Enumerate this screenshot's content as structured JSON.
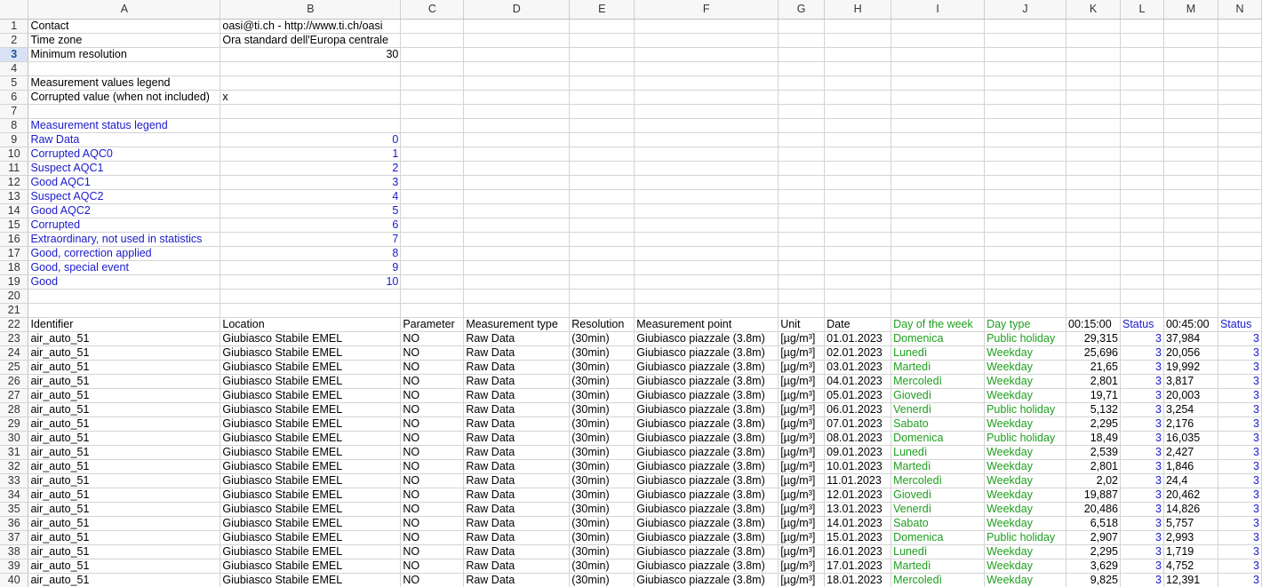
{
  "columns": [
    "A",
    "B",
    "C",
    "D",
    "E",
    "F",
    "G",
    "H",
    "I",
    "J",
    "K",
    "L",
    "M",
    "N"
  ],
  "selected_row": 3,
  "meta": {
    "contact_label": "Contact",
    "contact_value": "oasi@ti.ch - http://www.ti.ch/oasi",
    "timezone_label": "Time zone",
    "timezone_value": "Ora standard dell'Europa centrale",
    "minres_label": "Minimum resolution",
    "minres_value": "30",
    "values_legend_title": "Measurement values legend",
    "corrupted_label": "Corrupted value (when not included)",
    "corrupted_value": "x",
    "status_legend_title": "Measurement status legend"
  },
  "status_legend": [
    {
      "label": "Raw Data",
      "code": "0"
    },
    {
      "label": "Corrupted AQC0",
      "code": "1"
    },
    {
      "label": "Suspect AQC1",
      "code": "2"
    },
    {
      "label": "Good AQC1",
      "code": "3"
    },
    {
      "label": "Suspect AQC2",
      "code": "4"
    },
    {
      "label": "Good AQC2",
      "code": "5"
    },
    {
      "label": "Corrupted",
      "code": "6"
    },
    {
      "label": "Extraordinary, not used in statistics",
      "code": "7"
    },
    {
      "label": "Good, correction applied",
      "code": "8"
    },
    {
      "label": "Good, special event",
      "code": "9"
    },
    {
      "label": "Good",
      "code": "10"
    }
  ],
  "headers": [
    "Identifier",
    "Location",
    "Parameter",
    "Measurement type",
    "Resolution",
    "Measurement point",
    "Unit",
    "Date",
    "Day of the week",
    "Day type",
    "00:15:00",
    "Status",
    "00:45:00",
    "Status"
  ],
  "data_rows": [
    [
      "air_auto_51",
      "Giubiasco Stabile EMEL",
      "NO",
      "Raw Data",
      "(30min)",
      "Giubiasco piazzale (3.8m)",
      "[µg/m³]",
      "01.01.2023",
      "Domenica",
      "Public holiday",
      "29,315",
      "3",
      "37,984",
      "3"
    ],
    [
      "air_auto_51",
      "Giubiasco Stabile EMEL",
      "NO",
      "Raw Data",
      "(30min)",
      "Giubiasco piazzale (3.8m)",
      "[µg/m³]",
      "02.01.2023",
      "Lunedì",
      "Weekday",
      "25,696",
      "3",
      "20,056",
      "3"
    ],
    [
      "air_auto_51",
      "Giubiasco Stabile EMEL",
      "NO",
      "Raw Data",
      "(30min)",
      "Giubiasco piazzale (3.8m)",
      "[µg/m³]",
      "03.01.2023",
      "Martedì",
      "Weekday",
      "21,65",
      "3",
      "19,992",
      "3"
    ],
    [
      "air_auto_51",
      "Giubiasco Stabile EMEL",
      "NO",
      "Raw Data",
      "(30min)",
      "Giubiasco piazzale (3.8m)",
      "[µg/m³]",
      "04.01.2023",
      "Mercoledì",
      "Weekday",
      "2,801",
      "3",
      "3,817",
      "3"
    ],
    [
      "air_auto_51",
      "Giubiasco Stabile EMEL",
      "NO",
      "Raw Data",
      "(30min)",
      "Giubiasco piazzale (3.8m)",
      "[µg/m³]",
      "05.01.2023",
      "Giovedì",
      "Weekday",
      "19,71",
      "3",
      "20,003",
      "3"
    ],
    [
      "air_auto_51",
      "Giubiasco Stabile EMEL",
      "NO",
      "Raw Data",
      "(30min)",
      "Giubiasco piazzale (3.8m)",
      "[µg/m³]",
      "06.01.2023",
      "Venerdì",
      "Public holiday",
      "5,132",
      "3",
      "3,254",
      "3"
    ],
    [
      "air_auto_51",
      "Giubiasco Stabile EMEL",
      "NO",
      "Raw Data",
      "(30min)",
      "Giubiasco piazzale (3.8m)",
      "[µg/m³]",
      "07.01.2023",
      "Sabato",
      "Weekday",
      "2,295",
      "3",
      "2,176",
      "3"
    ],
    [
      "air_auto_51",
      "Giubiasco Stabile EMEL",
      "NO",
      "Raw Data",
      "(30min)",
      "Giubiasco piazzale (3.8m)",
      "[µg/m³]",
      "08.01.2023",
      "Domenica",
      "Public holiday",
      "18,49",
      "3",
      "16,035",
      "3"
    ],
    [
      "air_auto_51",
      "Giubiasco Stabile EMEL",
      "NO",
      "Raw Data",
      "(30min)",
      "Giubiasco piazzale (3.8m)",
      "[µg/m³]",
      "09.01.2023",
      "Lunedì",
      "Weekday",
      "2,539",
      "3",
      "2,427",
      "3"
    ],
    [
      "air_auto_51",
      "Giubiasco Stabile EMEL",
      "NO",
      "Raw Data",
      "(30min)",
      "Giubiasco piazzale (3.8m)",
      "[µg/m³]",
      "10.01.2023",
      "Martedì",
      "Weekday",
      "2,801",
      "3",
      "1,846",
      "3"
    ],
    [
      "air_auto_51",
      "Giubiasco Stabile EMEL",
      "NO",
      "Raw Data",
      "(30min)",
      "Giubiasco piazzale (3.8m)",
      "[µg/m³]",
      "11.01.2023",
      "Mercoledì",
      "Weekday",
      "2,02",
      "3",
      "24,4",
      "3"
    ],
    [
      "air_auto_51",
      "Giubiasco Stabile EMEL",
      "NO",
      "Raw Data",
      "(30min)",
      "Giubiasco piazzale (3.8m)",
      "[µg/m³]",
      "12.01.2023",
      "Giovedì",
      "Weekday",
      "19,887",
      "3",
      "20,462",
      "3"
    ],
    [
      "air_auto_51",
      "Giubiasco Stabile EMEL",
      "NO",
      "Raw Data",
      "(30min)",
      "Giubiasco piazzale (3.8m)",
      "[µg/m³]",
      "13.01.2023",
      "Venerdì",
      "Weekday",
      "20,486",
      "3",
      "14,826",
      "3"
    ],
    [
      "air_auto_51",
      "Giubiasco Stabile EMEL",
      "NO",
      "Raw Data",
      "(30min)",
      "Giubiasco piazzale (3.8m)",
      "[µg/m³]",
      "14.01.2023",
      "Sabato",
      "Weekday",
      "6,518",
      "3",
      "5,757",
      "3"
    ],
    [
      "air_auto_51",
      "Giubiasco Stabile EMEL",
      "NO",
      "Raw Data",
      "(30min)",
      "Giubiasco piazzale (3.8m)",
      "[µg/m³]",
      "15.01.2023",
      "Domenica",
      "Public holiday",
      "2,907",
      "3",
      "2,993",
      "3"
    ],
    [
      "air_auto_51",
      "Giubiasco Stabile EMEL",
      "NO",
      "Raw Data",
      "(30min)",
      "Giubiasco piazzale (3.8m)",
      "[µg/m³]",
      "16.01.2023",
      "Lunedì",
      "Weekday",
      "2,295",
      "3",
      "1,719",
      "3"
    ],
    [
      "air_auto_51",
      "Giubiasco Stabile EMEL",
      "NO",
      "Raw Data",
      "(30min)",
      "Giubiasco piazzale (3.8m)",
      "[µg/m³]",
      "17.01.2023",
      "Martedì",
      "Weekday",
      "3,629",
      "3",
      "4,752",
      "3"
    ],
    [
      "air_auto_51",
      "Giubiasco Stabile EMEL",
      "NO",
      "Raw Data",
      "(30min)",
      "Giubiasco piazzale (3.8m)",
      "[µg/m³]",
      "18.01.2023",
      "Mercoledì",
      "Weekday",
      "9,825",
      "3",
      "12,391",
      "3"
    ]
  ]
}
